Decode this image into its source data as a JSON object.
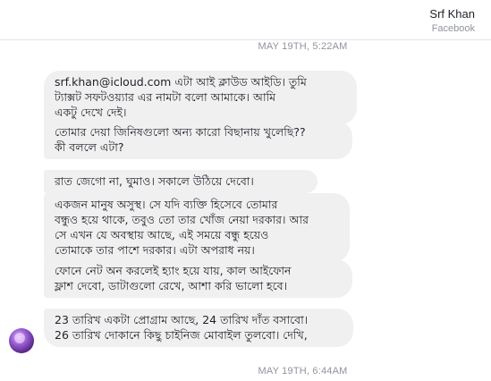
{
  "header": {
    "name": "Srf Khan",
    "platform": "Facebook"
  },
  "timestamps": {
    "top": "MAY 19TH, 5:22AM",
    "bottom": "MAY 19TH, 6:44AM"
  },
  "messages": [
    "srf.khan@icloud.com এটা আই ক্লাউড আইডি। তুমি\nট্যাক্সট সফটওয়্যার এর নামটা বলো আমাকে। আমি\nএকটু দেখে দেই।",
    "তোমার দেয়া জিনিষগুলো অন্য কারো বিছানায় খুলেছি??\nকী বললে এটা?",
    "রাত জেগো না, ঘুমাও। সকালে উঠিয়ে দেবো।",
    "একজন মানুষ অসুস্থ। সে যদি ব্যক্তি হিসেবে তোমার\nবন্ধুও হয়ে থাকে, তবুও তো তার খোঁজ নেয়া দরকার। আর\nসে এখন যে অবস্থায় আছে, এই সময়ে বন্ধু হয়েও\nতোমাকে তার পাশে দরকার। এটা অপরাধ নয়।",
    "ফোনে নেট অন করলেই হ্যাং হয়ে যায়, কাল আইফোন\nফ্লাশ দেবো, ডাটাগুলো রেখে, আশা করি ভালো হবে।",
    "23 তারিখ একটা প্রোগ্রাম আছে, 24 তারিখ দাঁত বসাবো।\n26 তারিখ দোকানে কিছু চাইনিজ মোবাইল তুলবো। দেখি,"
  ]
}
